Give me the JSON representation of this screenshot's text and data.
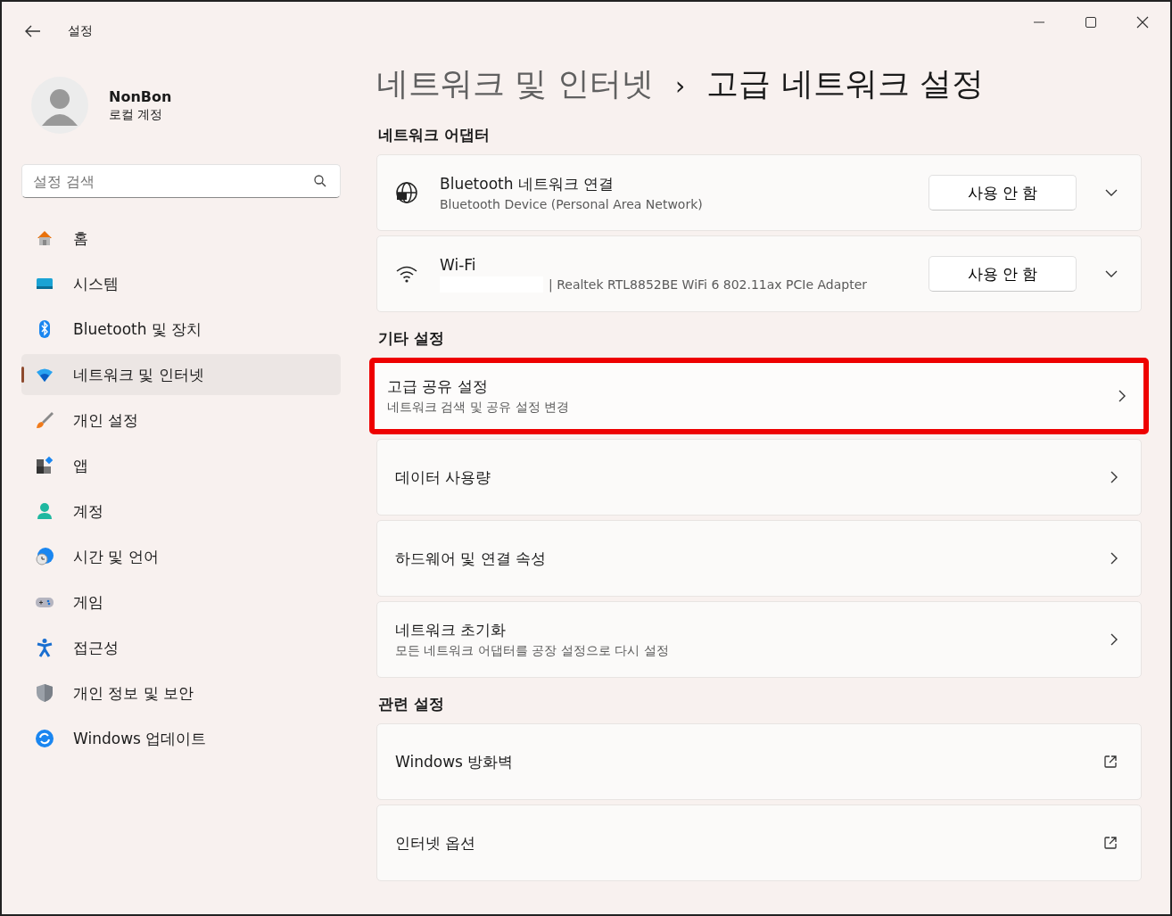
{
  "window": {
    "title": "설정"
  },
  "user": {
    "name": "NonBon",
    "account": "로컬 계정"
  },
  "search": {
    "placeholder": "설정 검색"
  },
  "sidebar": {
    "items": [
      {
        "label": "홈",
        "selected": false
      },
      {
        "label": "시스템",
        "selected": false
      },
      {
        "label": "Bluetooth 및 장치",
        "selected": false
      },
      {
        "label": "네트워크 및 인터넷",
        "selected": true
      },
      {
        "label": "개인 설정",
        "selected": false
      },
      {
        "label": "앱",
        "selected": false
      },
      {
        "label": "계정",
        "selected": false
      },
      {
        "label": "시간 및 언어",
        "selected": false
      },
      {
        "label": "게임",
        "selected": false
      },
      {
        "label": "접근성",
        "selected": false
      },
      {
        "label": "개인 정보 및 보안",
        "selected": false
      },
      {
        "label": "Windows 업데이트",
        "selected": false
      }
    ]
  },
  "breadcrumb": {
    "parent": "네트워크 및 인터넷",
    "separator": "›",
    "current": "고급 네트워크 설정"
  },
  "sections": [
    {
      "title": "네트워크 어댑터",
      "items": [
        {
          "kind": "adapter",
          "title": "Bluetooth 네트워크 연결",
          "subtitle": "Bluetooth Device (Personal Area Network)",
          "redacted": false,
          "button": "사용 안 함",
          "highlighted": false
        },
        {
          "kind": "adapter",
          "title": "Wi-Fi",
          "subtitle": "| Realtek RTL8852BE WiFi 6 802.11ax PCIe Adapter",
          "redacted": true,
          "button": "사용 안 함",
          "highlighted": false
        }
      ]
    },
    {
      "title": "기타 설정",
      "items": [
        {
          "kind": "link",
          "title": "고급 공유 설정",
          "subtitle": "네트워크 검색 및 공유 설정 변경",
          "highlighted": true
        },
        {
          "kind": "link",
          "title": "데이터 사용량",
          "highlighted": false
        },
        {
          "kind": "link",
          "title": "하드웨어 및 연결 속성",
          "highlighted": false
        },
        {
          "kind": "link",
          "title": "네트워크 초기화",
          "subtitle": "모든 네트워크 어댑터를 공장 설정으로 다시 설정",
          "highlighted": false
        }
      ]
    },
    {
      "title": "관련 설정",
      "items": [
        {
          "kind": "external",
          "title": "Windows 방화벽",
          "highlighted": false
        },
        {
          "kind": "external",
          "title": "인터넷 옵션",
          "highlighted": false
        }
      ]
    }
  ]
}
